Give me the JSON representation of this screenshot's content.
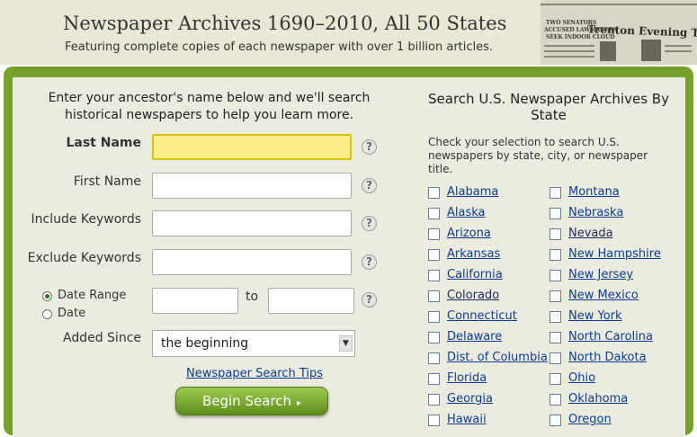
{
  "banner": {
    "title": "Newspaper Archives 1690–2010, All 50 States",
    "subtitle": "Featuring complete copies of each newspaper with over 1 billion articles.",
    "image": {
      "headline": "Trenton Evening Time",
      "snippets": [
        "TWO SENATORS",
        "ACCUSED LAWMAKERS",
        "SEEK INDOOR CLOUD"
      ]
    }
  },
  "form": {
    "intro": "Enter your ancestor's name below and we'll search historical newspapers to help you learn more.",
    "last_name_label": "Last Name",
    "first_name_label": "First Name",
    "include_keywords_label": "Include Keywords",
    "exclude_keywords_label": "Exclude Keywords",
    "date_range_label": "Date Range",
    "date_label": "Date",
    "to_label": "to",
    "added_since_label": "Added Since",
    "added_since_value": "the beginning",
    "help_glyph": "?",
    "tips_link": "Newspaper Search Tips",
    "search_button": "Begin Search",
    "search_button_icon": "▸"
  },
  "states_panel": {
    "title": "Search U.S. Newspaper Archives By State",
    "description": "Check your selection to search U.S. newspapers by state, city, or newspaper title.",
    "left_column": [
      "Alabama",
      "Alaska",
      "Arizona",
      "Arkansas",
      "California",
      "Colorado",
      "Connecticut",
      "Delaware",
      "Dist. of Columbia",
      "Florida",
      "Georgia",
      "Hawaii"
    ],
    "right_column": [
      "Montana",
      "Nebraska",
      "Nevada",
      "New Hampshire",
      "New Jersey",
      "New Mexico",
      "New York",
      "North Carolina",
      "North Dakota",
      "Ohio",
      "Oklahoma",
      "Oregon"
    ]
  },
  "colors": {
    "accent_green": "#74a22a",
    "link_blue": "#0b3d91",
    "highlight_field": "#fbef8a",
    "panel_bg": "#ecebe0"
  }
}
